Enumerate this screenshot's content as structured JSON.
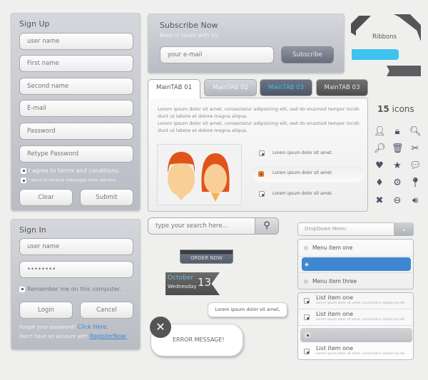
{
  "signup": {
    "title": "Sign Up",
    "fields": [
      "user name",
      "First name",
      "Second name",
      "E-mail",
      "Password",
      "Retype Password"
    ],
    "check1": "I agree to terms and conditions.",
    "check2": "I want to receive messages from admins.",
    "clear": "Clear",
    "submit": "Submit"
  },
  "subscribe": {
    "title": "Subscribe Now",
    "subtitle": "Keep in touch with Us.",
    "placeholder": "your e-mail",
    "button": "Subscribe"
  },
  "ribbons": {
    "label": "Ribbons",
    "accent": "#3ec2ee"
  },
  "tabs": {
    "items": [
      "MainTAB 01",
      "MainTAB 02",
      "MainTAB 03",
      "MainTAB 03"
    ],
    "active": 0,
    "para1": "Lorem ipsum dolor sit amet, consectetur adipisicing elit, sed do eiusmod tempor incidi-dunt ut labore et dolore magna aliqua.",
    "para2": "Lorem ipsum dolor sit amet, consectetur adipisicing elit, sed do eiusmod tempor incidi-dunt ut labore et dolore magna aliqua.",
    "options": [
      "Lorem ipsum dolor sit amet.",
      "Lorem ipsum dolor sit amet.",
      "Lorem ipsum dolor sit amet."
    ],
    "selected_option": 1,
    "accent": "#f07a22"
  },
  "icons": {
    "count": "15",
    "label": "icons",
    "items": [
      "user-icon",
      "lock-icon",
      "zoom-in-icon",
      "zoom-out-icon",
      "trash-icon",
      "scissors-icon",
      "heart-icon",
      "star-icon",
      "chat-icon",
      "pin-icon",
      "gear-icon",
      "location-icon",
      "close-circle-icon",
      "minus-circle-icon",
      "speaker-icon"
    ]
  },
  "signin": {
    "title": "Sign In",
    "username": "user name",
    "password": "••••••••",
    "remember": "Remember me on this computer.",
    "login": "Login",
    "cancel": "Cancel",
    "forgot": "Forgot your password?",
    "click_here": "Click Here.",
    "no_account": "Don't have an account yet?",
    "register": "RegisterNow."
  },
  "search": {
    "placeholder": "type your search here..."
  },
  "order": {
    "label": "ORDER NOW"
  },
  "date": {
    "month": "October",
    "weekday": "Wednesday",
    "day": "13"
  },
  "bubble": {
    "text": "Lorem ipsum dolor sit amet,"
  },
  "error": {
    "text": "ERROR MESSAGE!"
  },
  "dropdown": {
    "label": "DropDown Menu",
    "items": [
      "Menu item  one",
      "",
      "Menu item three"
    ],
    "selected": 1,
    "accent": "#3f88d1"
  },
  "list": {
    "items": [
      {
        "title": "List item one",
        "desc": "Lorem ipsum dolor sit amet, consectetur adipiscing elit."
      },
      {
        "title": "List item one",
        "desc": "Lorem ipsum dolor sit amet, consectetur adipiscing elit."
      },
      {
        "title": "",
        "desc": ""
      },
      {
        "title": "List item one",
        "desc": "Lorem ipsum dolor sit amet, consectetur adipiscing elit."
      }
    ],
    "selected": 2
  }
}
